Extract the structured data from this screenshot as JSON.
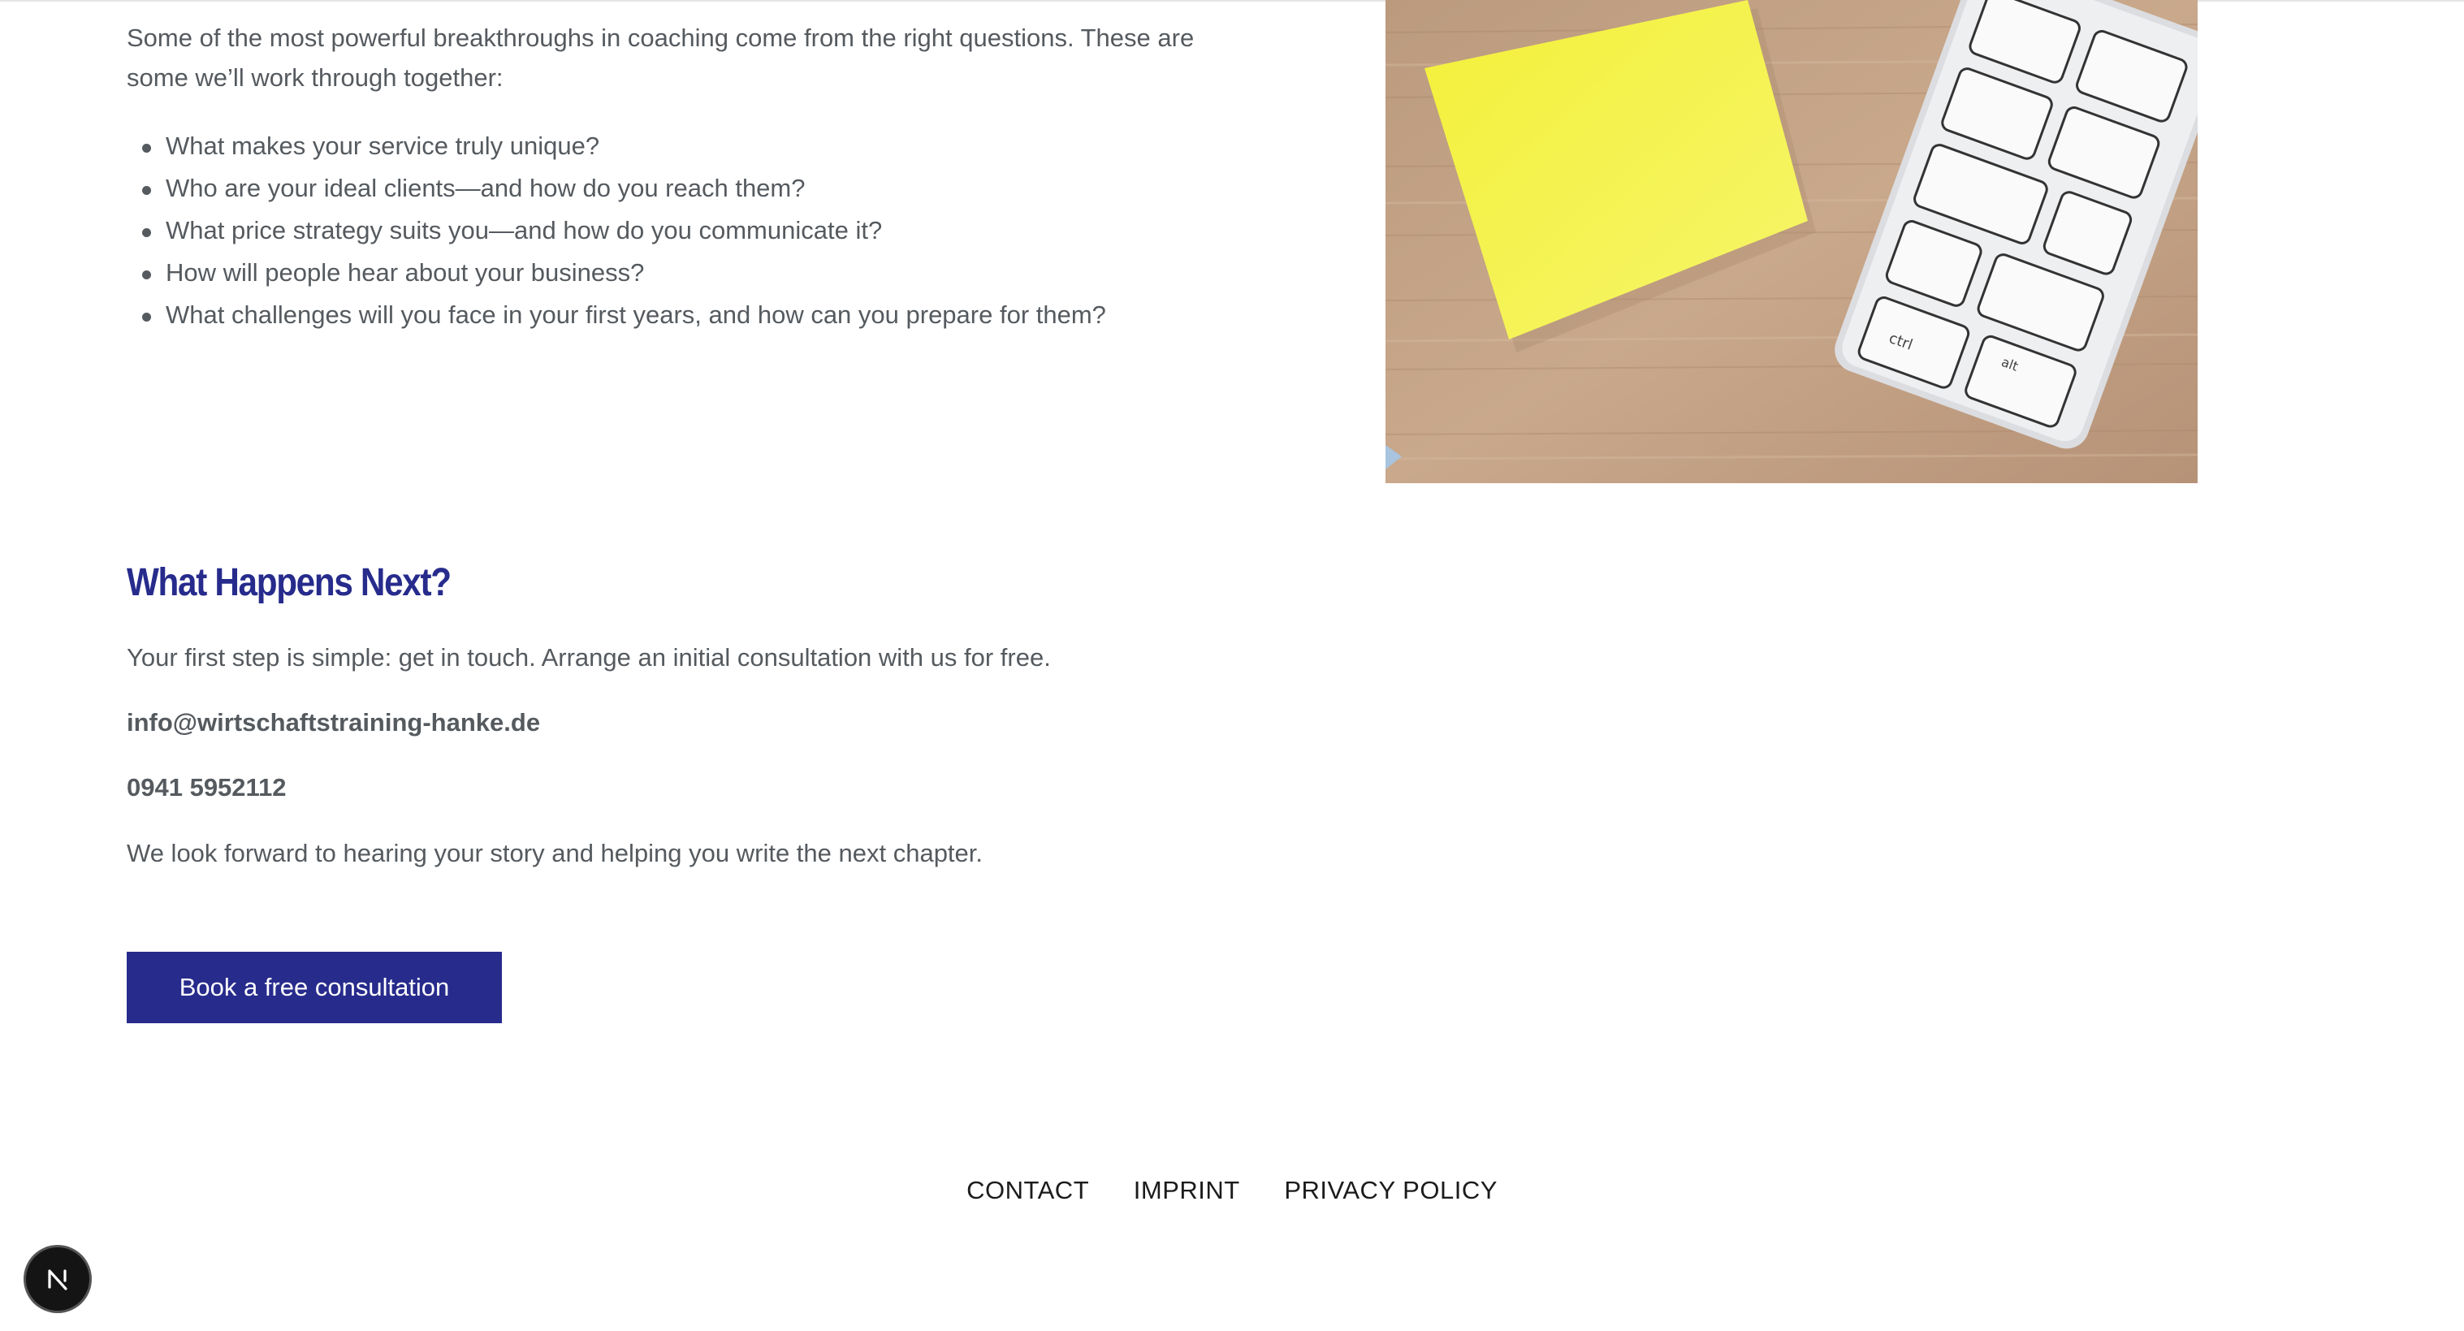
{
  "intro": {
    "text": "Some of the most powerful breakthroughs in coaching come from the right questions. These are some we’ll work through together:"
  },
  "questions": [
    "What makes your service truly unique?",
    "Who are your ideal clients—and how do you reach them?",
    "What price strategy suits you—and how do you communicate it?",
    "How will people hear about your business?",
    "What challenges will you face in your first years, and how can you prepare for them?"
  ],
  "image": {
    "description_icon": "sticky-note-keyboard-photo",
    "keyboard_keys": [
      "alt",
      "ctrl"
    ]
  },
  "next": {
    "heading": "What Happens Next?",
    "intro": "Your first step is simple: get in touch. Arrange an initial consultation with us for free.",
    "email": "info@wirtschaftstraining-hanke.de",
    "phone": "0941 5952112",
    "closing": "We look forward to hearing your story and helping you write the next chapter."
  },
  "cta": {
    "label": "Book a free consultation"
  },
  "footer": {
    "links": [
      "CONTACT",
      "IMPRINT",
      "PRIVACY POLICY"
    ]
  },
  "badge": {
    "letter": "N",
    "icon": "nextjs-dev-indicator-icon"
  },
  "colors": {
    "accent": "#272b8c",
    "text": "#555a5f",
    "footer_text": "#1b1b1b"
  }
}
